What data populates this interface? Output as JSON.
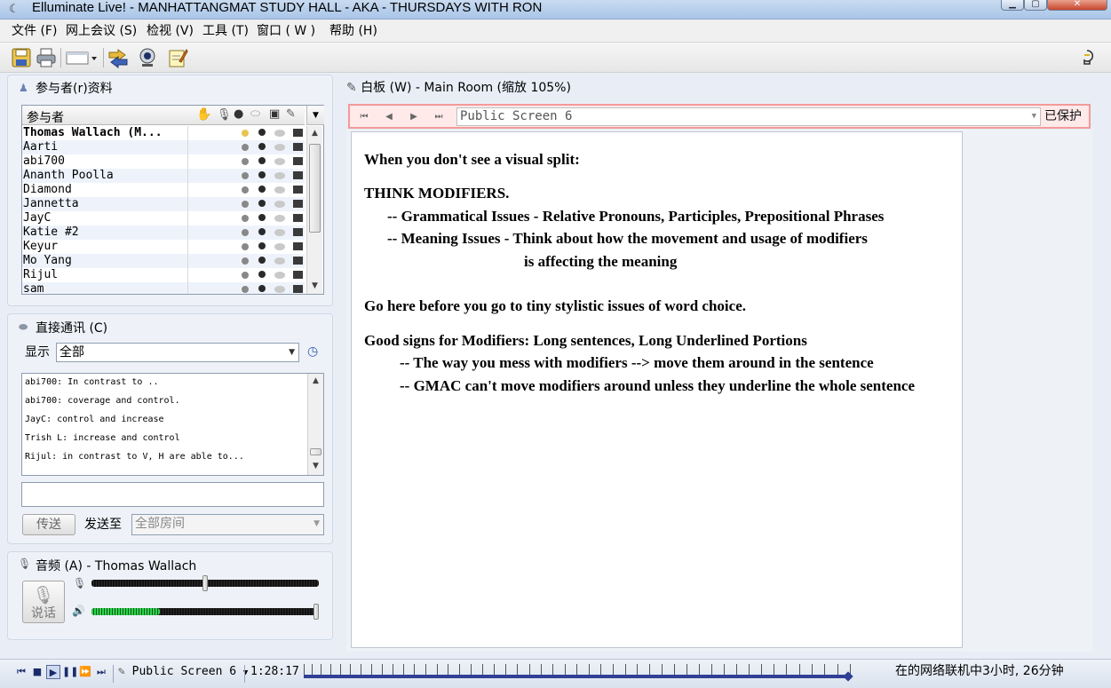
{
  "window": {
    "title": "Elluminate Live! - MANHATTANGMAT STUDY HALL - AKA - THURSDAYS WITH RON",
    "minimize": "▁",
    "maximize": "▢",
    "close": "✕"
  },
  "menu": [
    "文件 (F)",
    "网上会议 (S)",
    "检视 (V)",
    "工具 (T)",
    "窗口 ( W )",
    "帮助 (H)"
  ],
  "toolbar": {
    "icons": [
      "save-icon",
      "print-icon",
      "layout-icon",
      "transfer-icon",
      "webcam-icon",
      "notes-icon",
      "lightbulb-icon"
    ]
  },
  "participants": {
    "title": "参与者(r)资料",
    "header": "参与者",
    "rows": [
      "Thomas Wallach (M...",
      "Aarti",
      "abi700",
      "Ananth Poolla",
      "Diamond",
      "Jannetta",
      "JayC",
      "Katie #2",
      "Keyur",
      "Mo Yang",
      "Rijul",
      "sam"
    ],
    "bold_first": true
  },
  "chat": {
    "title": "直接通讯 (C)",
    "show_label": "显示",
    "show_value": "全部",
    "messages": [
      "abi700: In contrast to ..",
      "abi700: coverage and control.",
      "JayC: control and increase",
      "Trish L: increase and control",
      "Rijul: in contrast to V, H are able to..."
    ],
    "input_value": "",
    "send_label": "传送",
    "send_to_label": "发送至",
    "send_to_value": "全部房间"
  },
  "audio": {
    "title": "音频 (A) - Thomas Wallach",
    "talk_label": "说话",
    "mic_level": 0.5,
    "speaker_level": 1.0,
    "speaker_activity": 0.3
  },
  "whiteboard": {
    "title": "白板 (W) - Main Room (缩放 105%)",
    "screen": "Public Screen 6",
    "protected_label": "已保护",
    "lines": [
      "When you don't see a visual split:",
      "THINK MODIFIERS.",
      "-- Grammatical Issues - Relative Pronouns, Participles, Prepositional Phrases",
      "-- Meaning Issues - Think about how the movement and usage of modifiers",
      "is affecting the meaning",
      "Go here before you go to tiny stylistic issues of word choice.",
      "Good signs for Modifiers: Long sentences, Long Underlined Portions",
      "-- The way you mess with modifiers --> move them around in the sentence",
      "-- GMAC can't move modifiers around unless they underline the whole sentence"
    ]
  },
  "playback": {
    "screen": "Public Screen 6",
    "elapsed": "1:28:17",
    "progress": 1.0,
    "status": "在的网络联机中3小时, 26分钟"
  },
  "colors": {
    "accent": "#2f3f96",
    "protected_border": "#f29a9a",
    "protected_bg": "#ffe9e9"
  }
}
